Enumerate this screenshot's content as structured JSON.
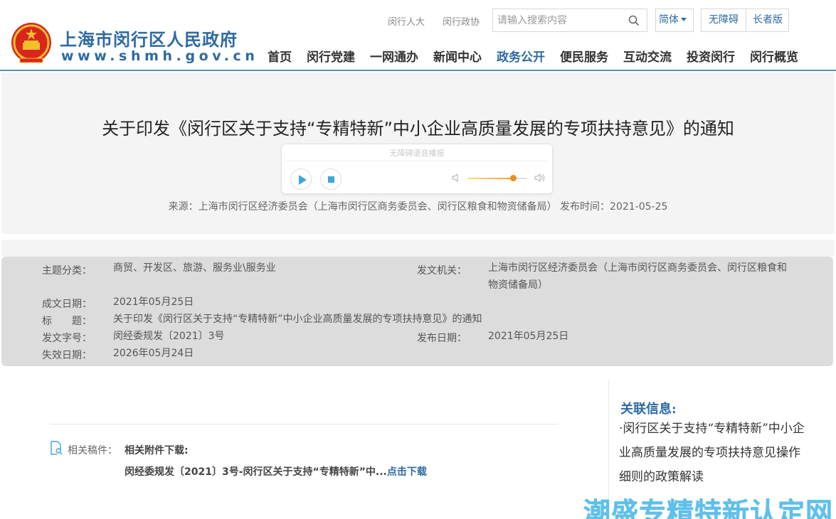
{
  "header": {
    "site_title": "上海市闵行区人民政府",
    "site_url": "www.shmh.gov.cn",
    "top_links": [
      "闵行人大",
      "闵行政协"
    ],
    "search_placeholder": "请输入搜索内容",
    "lang_label": "简体",
    "accessibility_label": "无障碍",
    "elderly_label": "长者版",
    "nav": [
      "首页",
      "闵行党建",
      "一网通办",
      "新闻中心",
      "政务公开",
      "便民服务",
      "互动交流",
      "投资闵行",
      "闵行概览"
    ],
    "active_nav": "政务公开",
    "brand_color": "#2d6aa3"
  },
  "article": {
    "title": "关于印发《闵行区关于支持“专精特新”中小企业高质量发展的专项扶持意见》的通知",
    "player_label": "无障碍语音播报",
    "volume_level": 0.77,
    "source_line": "来源：上海市闵行区经济委员会（上海市闵行区商务委员会、闵行区粮食和物资储备局）  发布时间：2021-05-25"
  },
  "info": {
    "topic_label": "主题分类：",
    "topic_value": "商贸、开发区、旅游、服务业\\服务业",
    "issuer_label": "发文机关：",
    "issuer_value_line1": "上海市闵行区经济委员会（上海市闵行区商务委员会、闵行区粮食和",
    "issuer_value_line2": "物资储备局）",
    "created_label": "成文日期：",
    "created_value": "2021年05月25日",
    "title_label": "标　　题：",
    "title_value": "关于印发《闵行区关于支持“专精特新”中小企业高质量发展的专项扶持意见》的通知",
    "docno_label": "发文字号：",
    "docno_value": "闵经委规发〔2021〕3号",
    "publish_label": "发布日期：",
    "publish_value": "2021年05月25日",
    "expire_label": "失效日期：",
    "expire_value": "2026年05月24日"
  },
  "attachments": {
    "label": "相关稿件：",
    "heading": "相关附件下载:",
    "file_name": "闵经委规发〔2021〕3号-闵行区关于支持“专精特新”中...",
    "download_link": "点击下载"
  },
  "related": {
    "title": "关联信息:",
    "item": "·闵行区关于支持“专精特新”中小企业高质量发展的专项扶持意见操作细则的政策解读"
  },
  "watermark": "潮盛专精特新认定网"
}
